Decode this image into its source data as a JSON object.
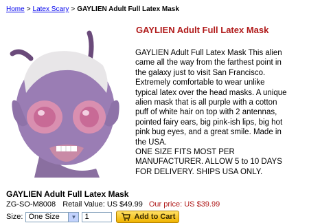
{
  "breadcrumb": {
    "home": "Home",
    "separator": ">",
    "category": "Latex Scary",
    "current": "GAYLIEN Adult Full Latex Mask"
  },
  "product": {
    "title": "GAYLIEN Adult Full Latex Mask",
    "description": "GAYLIEN Adult Full Latex Mask This alien came all the way from the farthest point in the galaxy just to visit San Francisco. Extremely comfortable to wear unlike typical latex over the head masks. A unique alien mask that is all purple with a cotton puff of white hair on top with 2 antennas, pointed fairy ears, big pink-ish lips, big hot pink bug eyes, and a great smile. Made in the USA.",
    "notice": "ONE SIZE FITS MOST PER MANUFACTURER. ALLOW 5 to 10 DAYS FOR DELIVERY. SHIPS USA ONLY.",
    "name": "GAYLIEN Adult Full Latex Mask",
    "sku": "ZG-SO-M8008",
    "retail_label": "Retail Value:",
    "retail_value": "US $49.99",
    "our_price_label": "Our price:",
    "our_price_value": "US $39.99"
  },
  "purchase": {
    "size_label": "Size:",
    "size_selected": "One Size",
    "quantity": "1",
    "add_to_cart_label": "Add to Cart"
  },
  "colors": {
    "title_red": "#b01a1a",
    "link_blue": "#0000ee"
  }
}
